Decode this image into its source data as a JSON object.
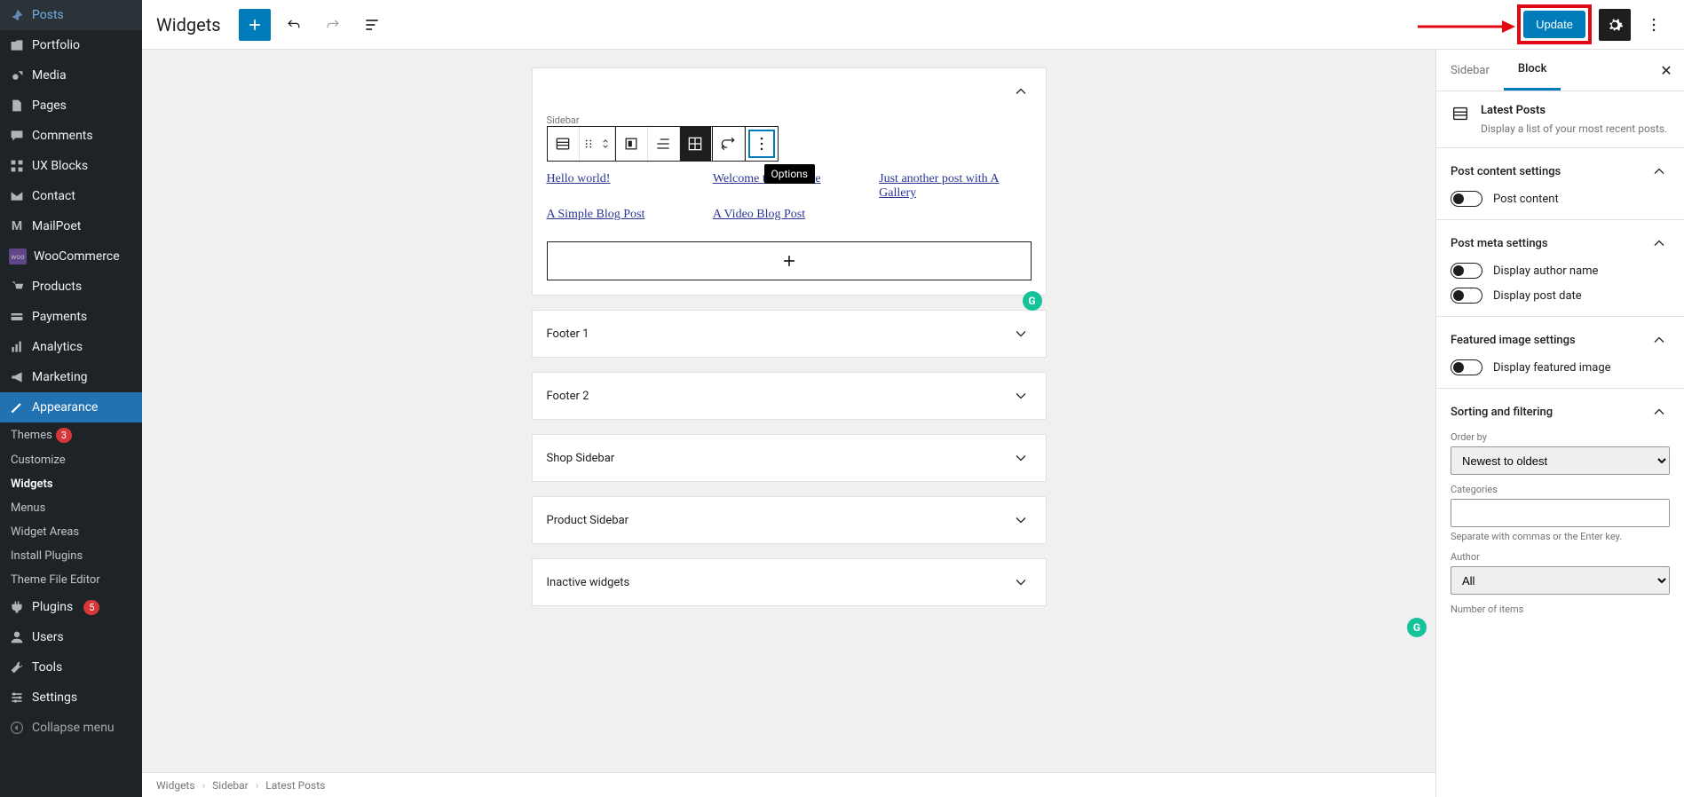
{
  "admin_menu": {
    "items": [
      {
        "icon": "pin",
        "label": "Posts"
      },
      {
        "icon": "portfolio",
        "label": "Portfolio"
      },
      {
        "icon": "media",
        "label": "Media"
      },
      {
        "icon": "page",
        "label": "Pages"
      },
      {
        "icon": "comment",
        "label": "Comments"
      },
      {
        "icon": "blocks",
        "label": "UX Blocks"
      },
      {
        "icon": "mail",
        "label": "Contact"
      },
      {
        "icon": "mailpoet",
        "label": "MailPoet"
      },
      {
        "icon": "woo",
        "label": "WooCommerce"
      },
      {
        "icon": "products",
        "label": "Products"
      },
      {
        "icon": "payments",
        "label": "Payments"
      },
      {
        "icon": "analytics",
        "label": "Analytics"
      },
      {
        "icon": "marketing",
        "label": "Marketing"
      },
      {
        "icon": "appearance",
        "label": "Appearance",
        "active": true
      },
      {
        "icon": "plugins",
        "label": "Plugins",
        "badge": "5"
      },
      {
        "icon": "users",
        "label": "Users"
      },
      {
        "icon": "tools",
        "label": "Tools"
      },
      {
        "icon": "settings",
        "label": "Settings"
      },
      {
        "icon": "collapse",
        "label": "Collapse menu"
      }
    ],
    "subitems": [
      {
        "label": "Themes",
        "badge": "3"
      },
      {
        "label": "Customize"
      },
      {
        "label": "Widgets",
        "current": true
      },
      {
        "label": "Menus"
      },
      {
        "label": "Widget Areas"
      },
      {
        "label": "Install Plugins"
      },
      {
        "label": "Theme File Editor"
      }
    ]
  },
  "toolbar": {
    "title": "Widgets",
    "update_label": "Update",
    "tooltip": "Options"
  },
  "canvas": {
    "sidebar_label": "Sidebar",
    "posts": [
      "Hello world!",
      "Welcome to Flatsome",
      "Just another post with A Gallery",
      "A Simple Blog Post",
      "A Video Blog Post"
    ],
    "areas": [
      "Footer 1",
      "Footer 2",
      "Shop Sidebar",
      "Product Sidebar",
      "Inactive widgets"
    ]
  },
  "settings": {
    "tabs": {
      "sidebar": "Sidebar",
      "block": "Block"
    },
    "block_title": "Latest Posts",
    "block_desc": "Display a list of your most recent posts.",
    "sections": {
      "post_content": {
        "title": "Post content settings",
        "toggle": "Post content"
      },
      "post_meta": {
        "title": "Post meta settings",
        "toggle1": "Display author name",
        "toggle2": "Display post date"
      },
      "featured": {
        "title": "Featured image settings",
        "toggle": "Display featured image"
      },
      "sorting": {
        "title": "Sorting and filtering",
        "order_by": "Order by",
        "order_by_value": "Newest to oldest",
        "categories": "Categories",
        "categories_help": "Separate with commas or the Enter key.",
        "author": "Author",
        "author_value": "All",
        "number": "Number of items"
      }
    }
  },
  "breadcrumb": [
    "Widgets",
    "Sidebar",
    "Latest Posts"
  ]
}
